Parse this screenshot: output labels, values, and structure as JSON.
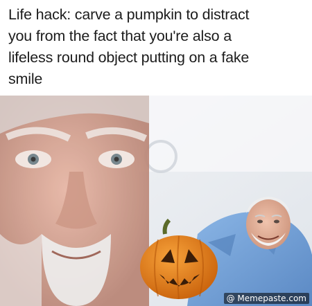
{
  "caption": {
    "lines": [
      "Life hack: carve a pumpkin to distract",
      "you from the fact that you're also a",
      "lifeless round object putting on a fake",
      "smile"
    ]
  },
  "watermark": {
    "text": "@ Memepaste.com"
  },
  "photo": {
    "pumpkin_color": "#e07a14",
    "shirt_color": "#6f9fd6",
    "background_color": "#eef1f5"
  }
}
